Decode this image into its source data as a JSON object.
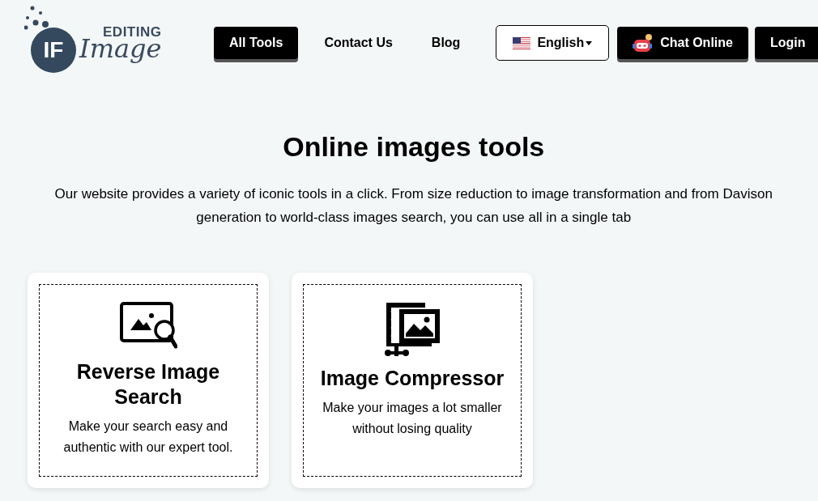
{
  "logo": {
    "badge": "IF",
    "top": "EDITING",
    "script": "Image"
  },
  "nav": [
    {
      "kind": "dark",
      "label": "All Tools"
    },
    {
      "kind": "plain",
      "label": "Contact Us"
    },
    {
      "kind": "plain",
      "label": "Blog"
    },
    {
      "kind": "language",
      "label": "English"
    },
    {
      "kind": "chat",
      "label": "Chat Online"
    },
    {
      "kind": "dark",
      "label": "Login"
    }
  ],
  "hero": {
    "title": "Online images tools",
    "text": "Our website provides a variety of iconic tools in a click. From size reduction to image transformation and from Davison generation to world-class images search, you can use all in a single tab"
  },
  "tools": [
    {
      "kind": "reverse-search",
      "title": "Reverse Image Search",
      "text": "Make your search easy and authentic with our expert tool."
    },
    {
      "kind": "compressor",
      "title": "Image Compressor",
      "text": "Make your images a lot smaller without losing quality"
    }
  ]
}
